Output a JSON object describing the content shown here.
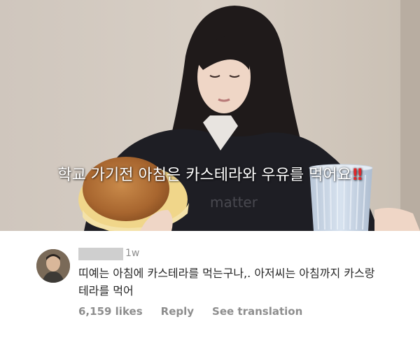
{
  "video": {
    "subtitle_text": "학교 가기전 아침은 카스테라와 우유를 먹어요",
    "subtitle_emphasis": "‼",
    "watermark_text": "matter"
  },
  "comment": {
    "username": "",
    "timestamp": "1w",
    "text": "띠예는 아침에 카스테라를 먹는구나,. 아저씨는 아침까지 카스랑 테라를 먹어",
    "likes": "6,159 likes",
    "reply_label": "Reply",
    "translation_label": "See translation"
  },
  "colors": {
    "subtitle": "#ffffff",
    "emphasis": "#e0262b",
    "meta_text": "#8e8e8e",
    "comment_text": "#262626"
  }
}
